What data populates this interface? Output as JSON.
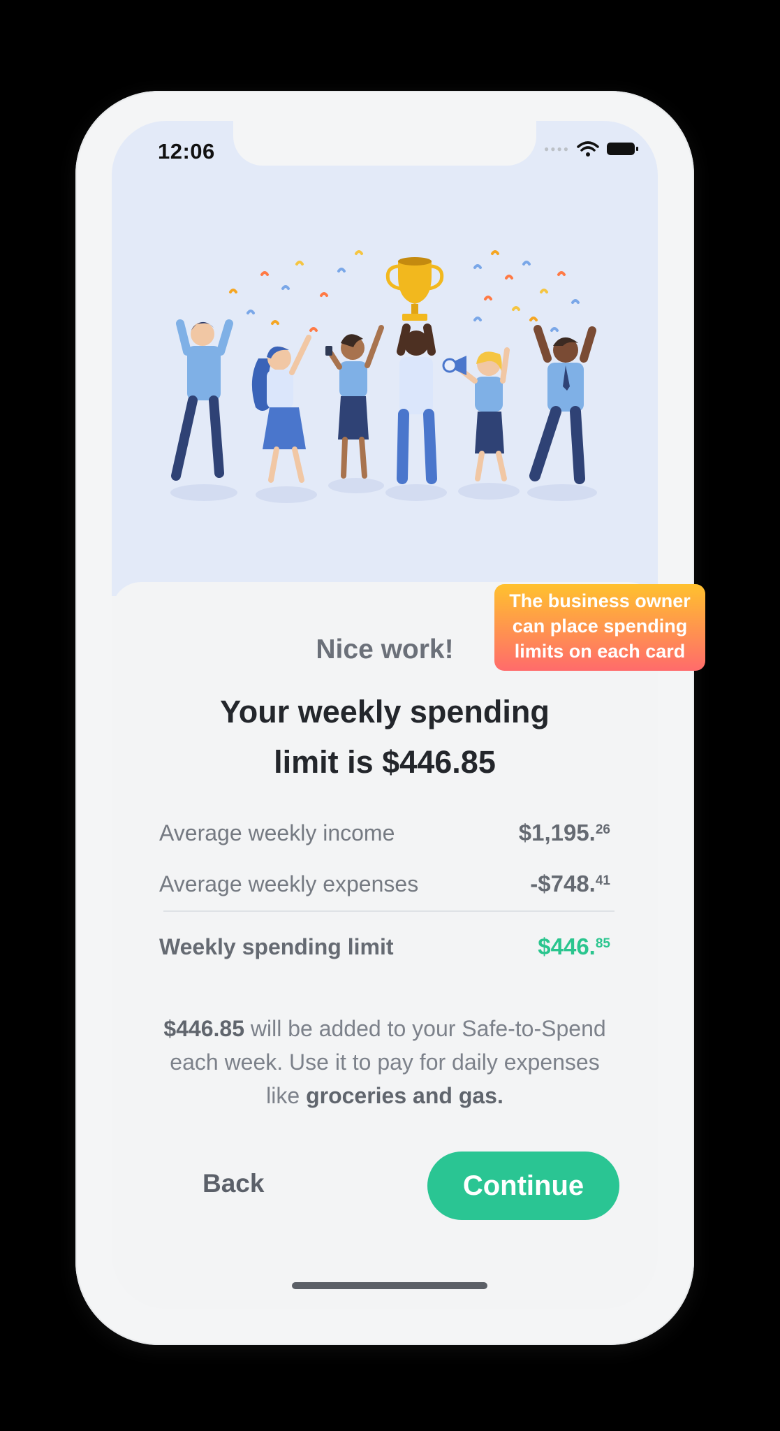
{
  "status_bar": {
    "time": "12:06"
  },
  "title": "Nice work!",
  "headline_line1": "Your weekly spending",
  "headline_line2": "limit is $446.85",
  "summary": {
    "income_label": "Average weekly income",
    "income_whole": "$1,195.",
    "income_cents": "26",
    "expenses_label": "Average weekly expenses",
    "expenses_whole": "-$748.",
    "expenses_cents": "41",
    "limit_label": "Weekly spending limit",
    "limit_whole": "$446.",
    "limit_cents": "85"
  },
  "info": {
    "amount": "$446.85",
    "text1": " will be added to your Safe-to-Spend each week. Use it to pay for daily expenses like ",
    "bold_tail": "groceries and gas."
  },
  "buttons": {
    "back": "Back",
    "continue": "Continue"
  },
  "callout": "The business owner can place spending limits on each card",
  "colors": {
    "accent_green": "#2ac593",
    "hero_bg": "#e3eaf8",
    "callout_top": "#ffc12e",
    "callout_bottom": "#ff6b6b"
  }
}
